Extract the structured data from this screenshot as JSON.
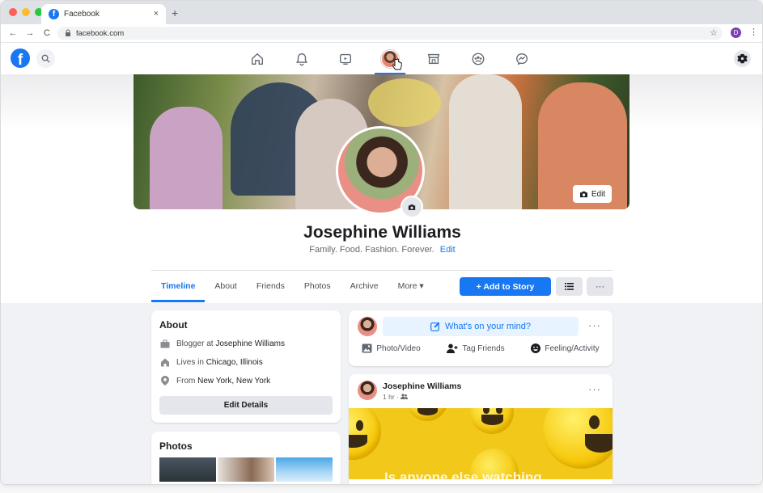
{
  "browser": {
    "tab_title": "Facebook",
    "tab_close": "×",
    "new_tab": "+",
    "url": "facebook.com",
    "profile_initial": "D",
    "back": "←",
    "forward": "→",
    "reload": "C",
    "star": "☆",
    "menu": "⋮"
  },
  "colors": {
    "brand": "#1877f2",
    "traffic": [
      "#ff5f57",
      "#febc2e",
      "#28c840"
    ]
  },
  "fbnav": {
    "logo": "f",
    "icons": [
      "home-icon",
      "notifications-icon",
      "watch-icon",
      "profile-icon",
      "marketplace-icon",
      "groups-icon",
      "messenger-icon"
    ],
    "active_index": 3
  },
  "profile": {
    "name": "Josephine Williams",
    "bio": "Family. Food. Fashion. Forever.",
    "bio_edit": "Edit",
    "cover_edit": "Edit"
  },
  "tabs": [
    {
      "label": "Timeline",
      "active": true
    },
    {
      "label": "About"
    },
    {
      "label": "Friends"
    },
    {
      "label": "Photos"
    },
    {
      "label": "Archive"
    },
    {
      "label": "More ▾"
    }
  ],
  "actions": {
    "add_story": "+ Add to Story",
    "more": "···"
  },
  "about": {
    "title": "About",
    "rows": [
      {
        "prefix": "Blogger at ",
        "value": "Josephine Williams"
      },
      {
        "prefix": "Lives in ",
        "value": "Chicago, Illinois"
      },
      {
        "prefix": "From ",
        "value": "New York, New York"
      }
    ],
    "edit_details": "Edit Details"
  },
  "photos": {
    "title": "Photos"
  },
  "composer": {
    "prompt": "What's on your mind?",
    "more": "···",
    "actions": [
      "Photo/Video",
      "Tag Friends",
      "Feeling/Activity"
    ]
  },
  "post": {
    "author": "Josephine Williams",
    "time": "1 hr ·",
    "more": "···",
    "overlay": "Is anyone else watching"
  }
}
